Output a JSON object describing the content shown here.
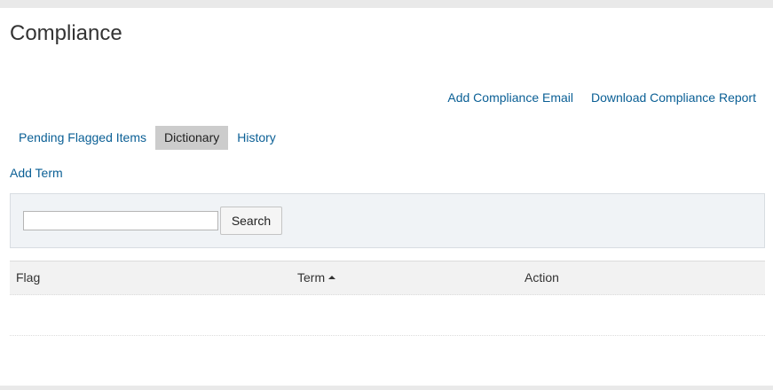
{
  "page": {
    "title": "Compliance"
  },
  "top_actions": {
    "add_email": "Add Compliance Email",
    "download_report": "Download Compliance Report"
  },
  "tabs": [
    {
      "label": "Pending Flagged Items",
      "active": false
    },
    {
      "label": "Dictionary",
      "active": true
    },
    {
      "label": "History",
      "active": false
    }
  ],
  "add_term": "Add Term",
  "search": {
    "value": "",
    "placeholder": "",
    "button_label": "Search"
  },
  "table": {
    "columns": [
      {
        "label": "Flag",
        "sort": null
      },
      {
        "label": "Term",
        "sort": "ascending"
      },
      {
        "label": "Action",
        "sort": null
      }
    ],
    "rows": []
  },
  "colors": {
    "link": "#0a5f95",
    "active_tab_bg": "#cccccc",
    "search_panel_bg": "#f0f3f6",
    "table_header_bg": "#f2f2f2"
  }
}
